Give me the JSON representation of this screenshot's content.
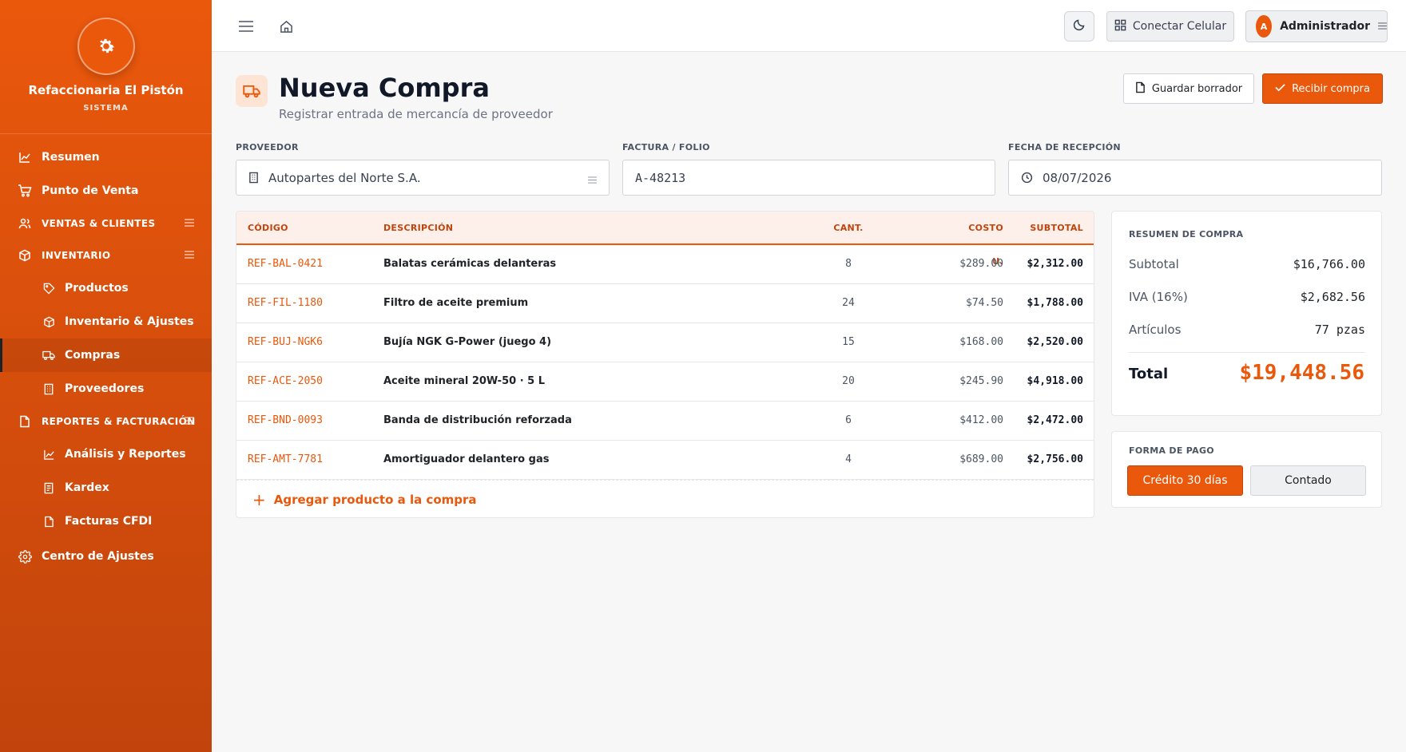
{
  "brand": {
    "name": "Refaccionaria El Pistón",
    "subtitle": "SISTEMA"
  },
  "nav": {
    "resumen": "Resumen",
    "punto_venta": "Punto de Venta",
    "ventas_clientes": "VENTAS & CLIENTES",
    "inventario": "INVENTARIO",
    "productos": "Productos",
    "inventario_ajustes": "Inventario & Ajustes",
    "compras": "Compras",
    "proveedores": "Proveedores",
    "reportes": "REPORTES & FACTURACIÓN",
    "analisis": "Análisis y Reportes",
    "kardex": "Kardex",
    "facturas": "Facturas CFDI",
    "centro_ajustes": "Centro de Ajustes"
  },
  "topbar": {
    "connect_phone": "Conectar Celular",
    "user_initial": "A",
    "user_name": "Administrador"
  },
  "page": {
    "title": "Nueva Compra",
    "subtitle": "Registrar entrada de mercancía de proveedor",
    "save_draft": "Guardar borrador",
    "receive": "Recibir compra"
  },
  "fields": {
    "proveedor_label": "PROVEEDOR",
    "proveedor_value": "Autopartes del Norte S.A.",
    "folio_label": "FACTURA / FOLIO",
    "folio_value": "A-48213",
    "fecha_label": "FECHA DE RECEPCIÓN",
    "fecha_value": "08/07/2026"
  },
  "table": {
    "headers": {
      "code": "CÓDIGO",
      "desc": "DESCRIPCIÓN",
      "qty": "CANT.",
      "cost": "COSTO U.",
      "subtotal": "SUBTOTAL"
    },
    "rows": [
      {
        "code": "REF-BAL-0421",
        "desc": "Balatas cerámicas delanteras",
        "qty": "8",
        "cost": "$289.00",
        "subtotal": "$2,312.00"
      },
      {
        "code": "REF-FIL-1180",
        "desc": "Filtro de aceite premium",
        "qty": "24",
        "cost": "$74.50",
        "subtotal": "$1,788.00"
      },
      {
        "code": "REF-BUJ-NGK6",
        "desc": "Bujía NGK G-Power (juego 4)",
        "qty": "15",
        "cost": "$168.00",
        "subtotal": "$2,520.00"
      },
      {
        "code": "REF-ACE-2050",
        "desc": "Aceite mineral 20W-50 · 5 L",
        "qty": "20",
        "cost": "$245.90",
        "subtotal": "$4,918.00"
      },
      {
        "code": "REF-BND-0093",
        "desc": "Banda de distribución reforzada",
        "qty": "6",
        "cost": "$412.00",
        "subtotal": "$2,472.00"
      },
      {
        "code": "REF-AMT-7781",
        "desc": "Amortiguador delantero gas",
        "qty": "4",
        "cost": "$689.00",
        "subtotal": "$2,756.00"
      }
    ],
    "add_label": "Agregar producto a la compra"
  },
  "summary": {
    "title": "RESUMEN DE COMPRA",
    "subtotal_label": "Subtotal",
    "subtotal_value": "$16,766.00",
    "iva_label": "IVA (16%)",
    "iva_value": "$2,682.56",
    "items_label": "Artículos",
    "items_value": "77 pzas",
    "total_label": "Total",
    "total_value": "$19,448.56"
  },
  "payment": {
    "title": "FORMA DE PAGO",
    "option_credit": "Crédito 30 días",
    "option_cash": "Contado",
    "selected": "Crédito 30 días"
  },
  "colors": {
    "accent": "#ea580c",
    "accent_dark": "#c2440c"
  }
}
